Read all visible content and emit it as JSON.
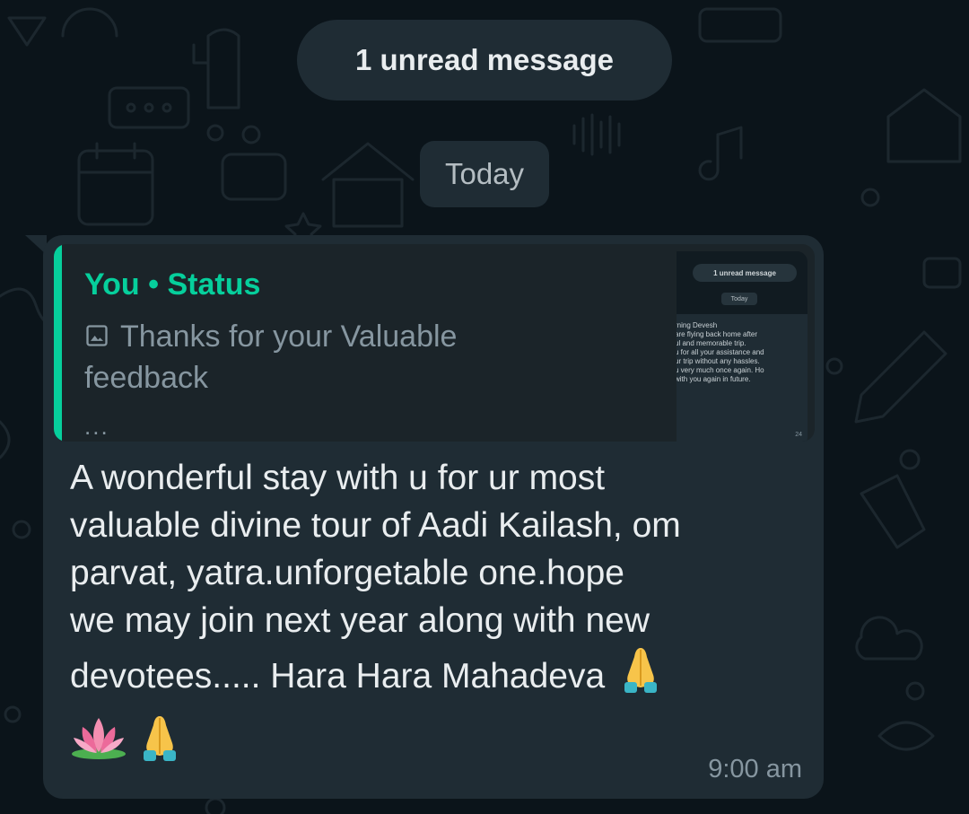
{
  "chat": {
    "unread_banner": "1 unread message",
    "date_separator": "Today"
  },
  "message": {
    "quote": {
      "author": "You • Status",
      "text": "Thanks for your Valuable feedback",
      "ellipsis": "...",
      "media_icon": "image-icon",
      "thumbnail": {
        "banner": "1 unread message",
        "date": "Today",
        "lines": [
          "rning Devesh",
          "are flying back home after",
          "ul and memorable trip.",
          "u for all your assistance and",
          "ur trip without any hassles.",
          "u very much once again. Ho",
          "with you again in future."
        ],
        "time": "24"
      }
    },
    "body_lines": [
      "A wonderful stay with u for ur most",
      "valuable divine tour of Aadi Kailash, om",
      "parvat, yatra.unforgetable one.hope",
      "we may join next year along with new",
      "devotees..... Hara Hara Mahadeva"
    ],
    "emojis": [
      "folded-hands-emoji",
      "lotus-emoji",
      "folded-hands-emoji"
    ],
    "time": "9:00 am"
  },
  "colors": {
    "background": "#0b141a",
    "bubble": "#1f2c34",
    "accent": "#06cf9c",
    "text_primary": "#e9edef",
    "text_secondary": "#8696a0"
  }
}
